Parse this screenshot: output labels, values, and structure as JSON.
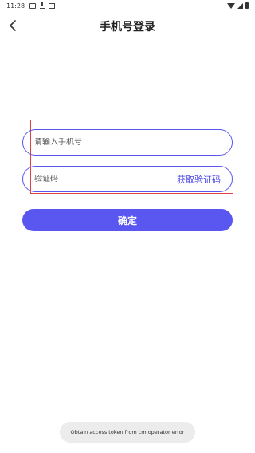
{
  "status_bar": {
    "time": "11:28",
    "left_icons": [
      "image-icon",
      "download-icon",
      "notification-icon"
    ],
    "right_icons": [
      "wifi-icon",
      "signal-icon",
      "battery-icon"
    ]
  },
  "nav": {
    "back_icon": "chevron-left-icon",
    "title": "手机号登录"
  },
  "form": {
    "phone_placeholder": "请输入手机号",
    "phone_value": "",
    "code_placeholder": "验证码",
    "code_value": "",
    "get_code_label": "获取验证码"
  },
  "confirm_label": "确定",
  "toast": "Obtain access token from cm operator error",
  "colors": {
    "accent": "#5a56f0",
    "link": "#4a47e8",
    "highlight_border": "#e04040",
    "toast_bg": "#ececec"
  }
}
